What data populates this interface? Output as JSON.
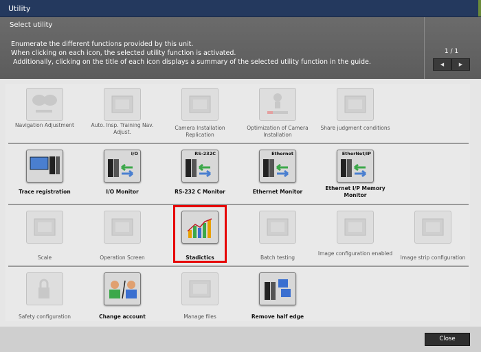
{
  "window": {
    "title": "Utility"
  },
  "header": {
    "select_label": "Select utility",
    "desc_line1": "Enumerate the different functions provided by this unit.",
    "desc_line2": "When clicking on each icon, the selected utility function is activated.",
    "desc_line3": " Additionally, clicking on the title of each icon displays a summary of the selected utility function in the guide.",
    "page": "1 / 1",
    "prev": "◀",
    "next": "▶"
  },
  "rows": [
    [
      {
        "label": "Navigation Adjustment",
        "enabled": false,
        "icon": "ng-ok-icon"
      },
      {
        "label": "Auto. Insp. Training Nav. Adjust.",
        "enabled": false,
        "icon": "ng-check-icon"
      },
      {
        "label": "Camera Installation Replication",
        "enabled": false,
        "icon": "camera-replicate-icon"
      },
      {
        "label": "Optimization of Camera Installation",
        "enabled": false,
        "icon": "camera-optimize-icon"
      },
      {
        "label": "Share judgment conditions",
        "enabled": false,
        "icon": "share-icon"
      }
    ],
    [
      {
        "label": "Trace registration",
        "enabled": true,
        "icon": "trace-icon"
      },
      {
        "label": "I/O Monitor",
        "enabled": true,
        "icon": "io-monitor-icon",
        "tag": "I/O"
      },
      {
        "label": "RS-232 C Monitor",
        "enabled": true,
        "icon": "rs232c-monitor-icon",
        "tag": "RS-232C"
      },
      {
        "label": "Ethernet Monitor",
        "enabled": true,
        "icon": "ethernet-monitor-icon",
        "tag": "Ethernet"
      },
      {
        "label": "Ethernet I/P Memory Monitor",
        "enabled": true,
        "icon": "ethernet-ip-icon",
        "tag": "EtherNet/IP"
      }
    ],
    [
      {
        "label": "Scale",
        "enabled": false,
        "icon": "scale-icon"
      },
      {
        "label": "Operation Screen",
        "enabled": false,
        "icon": "operation-screen-icon"
      },
      {
        "label": "Stadictics",
        "enabled": true,
        "icon": "statistics-icon"
      },
      {
        "label": "Batch testing",
        "enabled": false,
        "icon": "batch-testing-icon"
      },
      {
        "label": "Image configuration enabled",
        "enabled": false,
        "icon": "image-config-icon"
      },
      {
        "label": "Image strip configuration",
        "enabled": false,
        "icon": "image-strip-icon"
      }
    ],
    [
      {
        "label": "Safety configuration",
        "enabled": false,
        "icon": "safety-lock-icon"
      },
      {
        "label": "Change account",
        "enabled": true,
        "icon": "change-account-icon"
      },
      {
        "label": "Manage files",
        "enabled": false,
        "icon": "manage-files-icon"
      },
      {
        "label": "Remove half edge",
        "enabled": true,
        "icon": "remove-half-edge-icon"
      }
    ]
  ],
  "footer": {
    "close": "Close"
  },
  "colors": {
    "title_bar": "#24395e",
    "header": "#5c5c5c",
    "highlight": "#e60000",
    "accent_green": "#3ca84a"
  }
}
